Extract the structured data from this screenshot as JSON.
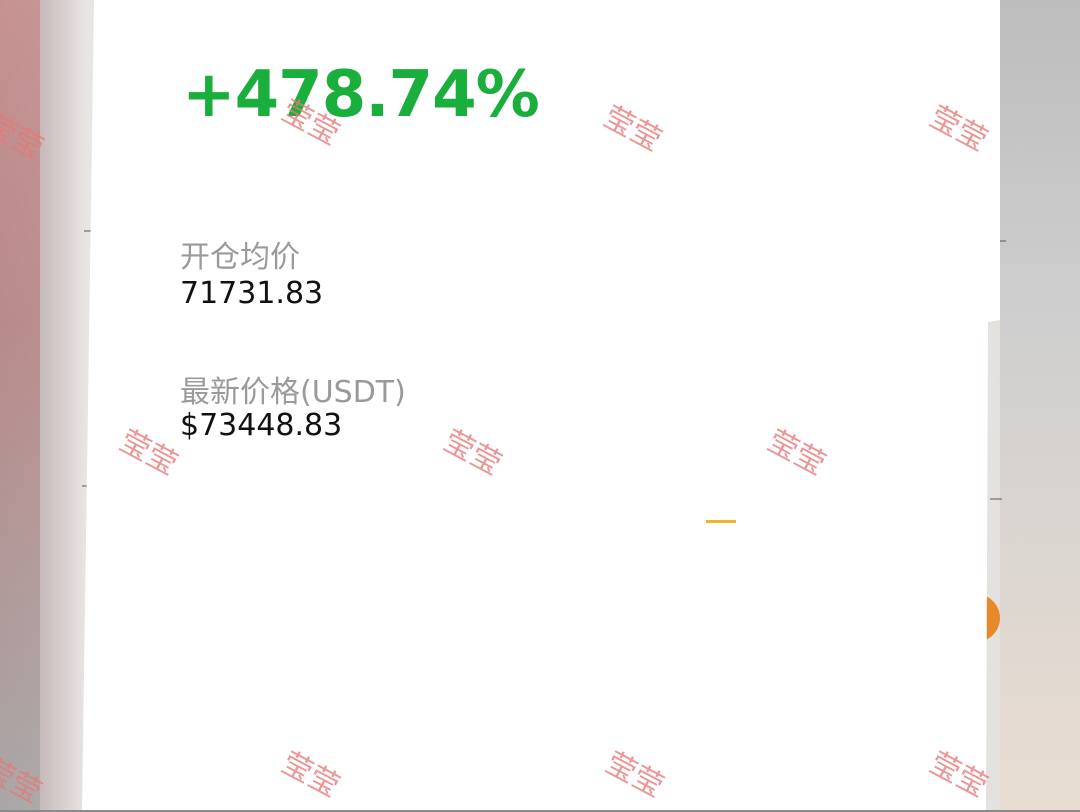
{
  "position": {
    "pnl_percent": "+478.74%",
    "open_avg_label": "开仓均价",
    "open_avg_value": "71731.83",
    "latest_price_label": "最新价格(USDT)",
    "latest_price_value": "$73448.83"
  },
  "watermark": {
    "text": "莹莹"
  },
  "colors": {
    "profit_green": "#1aae3c",
    "label_gray": "#9a9a9a",
    "watermark_red": "#e57a7a",
    "orange_accent": "#e7882b"
  }
}
